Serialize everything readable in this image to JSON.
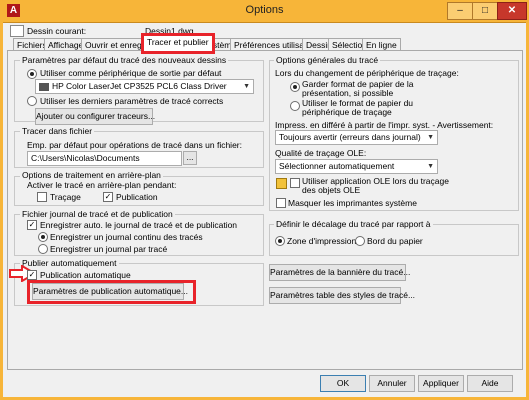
{
  "window": {
    "title": "Options",
    "app_icon": "A",
    "minimize": "–",
    "maximize": "□",
    "close": "✕"
  },
  "header": {
    "current_drawing_label": "Dessin courant:",
    "current_drawing_value": "Dessin1.dwg"
  },
  "tabs": [
    {
      "label": "Fichiers"
    },
    {
      "label": "Affichage"
    },
    {
      "label": "Ouvrir et enregistrer"
    },
    {
      "label": "Tracer et publier"
    },
    {
      "label": "Système"
    },
    {
      "label": "Préférences utilisateur"
    },
    {
      "label": "Dessin"
    },
    {
      "label": "Sélection"
    },
    {
      "label": "En ligne"
    }
  ],
  "default_plot": {
    "title": "Paramètres par défaut du tracé des nouveaux dessins",
    "use_device_label": "Utiliser comme périphérique de sortie par défaut",
    "device": "HP Color LaserJet CP3525 PCL6 Class Driver",
    "use_last_label": "Utiliser les derniers paramètres de tracé corrects",
    "add_plotters_button": "Ajouter ou configurer traceurs..."
  },
  "plot_file": {
    "title": "Tracer dans fichier",
    "location_label": "Emp. par défaut pour opérations de tracé dans un fichier:",
    "path": "C:\\Users\\Nicolas\\Documents",
    "browse_button": "..."
  },
  "background": {
    "title": "Options de traitement en arrière-plan",
    "enable_label": "Activer le tracé en arrière-plan pendant:",
    "plot_label": "Traçage",
    "publish_label": "Publication"
  },
  "log": {
    "title": "Fichier journal de tracé et de publication",
    "auto_save_label": "Enregistrer auto. le journal de tracé et de publication",
    "continuous_label": "Enregistrer un journal continu des tracés",
    "per_plot_label": "Enregistrer un journal par tracé"
  },
  "auto_publish": {
    "title": "Publier automatiquement",
    "checkbox_label": "Publication automatique",
    "settings_button": "Paramètres de publication automatique..."
  },
  "general": {
    "title": "Options générales du tracé",
    "device_change_label": "Lors du changement de périphérique de traçage:",
    "keep_paper_label": "Garder format de papier de la présentation, si possible",
    "use_device_paper_label": "Utiliser le format de papier du périphérique de traçage",
    "spool_label": "Impress. en différé à partir de l'impr. syst. - Avertissement:",
    "spool_value": "Toujours avertir (erreurs dans journal)",
    "ole_label": "Qualité de traçage OLE:",
    "ole_value": "Sélectionner automatiquement",
    "use_ole_app_label": "Utiliser application OLE lors du traçage des objets OLE",
    "hide_printers_label": "Masquer les imprimantes système"
  },
  "offset": {
    "title": "Définir le décalage du tracé par rapport à",
    "printable_label": "Zone d'impression",
    "paper_edge_label": "Bord du papier"
  },
  "side_buttons": {
    "stamp": "Paramètres de la bannière du tracé...",
    "styles": "Paramètres table des styles de tracé..."
  },
  "footer": {
    "ok": "OK",
    "cancel": "Annuler",
    "apply": "Appliquer",
    "help": "Aide"
  },
  "check_mark": "✓",
  "dropdown_arrow": "▼"
}
